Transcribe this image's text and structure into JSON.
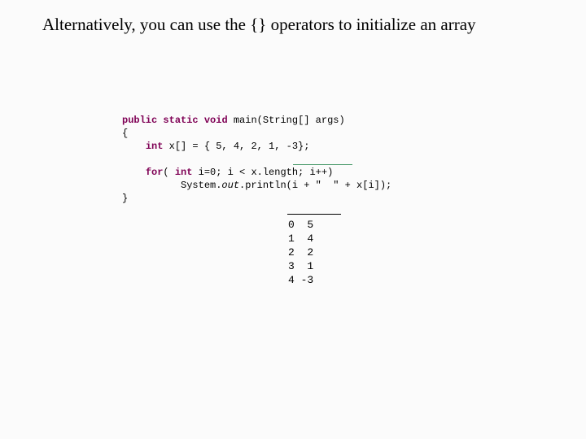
{
  "title": "Alternatively, you can use the {} operators to initialize an array",
  "code": {
    "kw_public": "public",
    "kw_static": "static",
    "kw_void": "void",
    "sig": " main(String[] args)",
    "l2": "{",
    "kw_int1": "int",
    "arr_decl": " x[] = { 5, 4, 2, 1, -3};",
    "kw_for": "for",
    "for_open": "( ",
    "kw_int2": "int",
    "for_rest": " i=0; i < x.length; i++)",
    "indent_print": "          System.",
    "out": "out",
    "print_rest": ".println(i + \"  \" + x[i]);",
    "l7": "}"
  },
  "output": {
    "r0": "0  5",
    "r1": "1  4",
    "r2": "2  2",
    "r3": "3  1",
    "r4": "4 -3"
  }
}
